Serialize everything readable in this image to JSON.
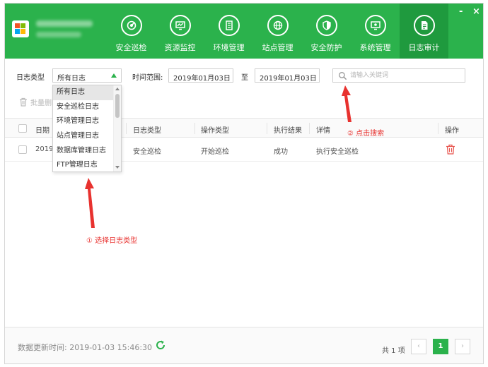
{
  "header": {
    "nav": [
      {
        "label": "安全巡检",
        "icon": "radar-icon"
      },
      {
        "label": "资源监控",
        "icon": "monitor-icon"
      },
      {
        "label": "环境管理",
        "icon": "server-icon"
      },
      {
        "label": "站点管理",
        "icon": "globe-icon"
      },
      {
        "label": "安全防护",
        "icon": "shield-icon"
      },
      {
        "label": "系统管理",
        "icon": "settings-monitor-icon"
      },
      {
        "label": "日志审计",
        "icon": "document-icon"
      }
    ],
    "active_tab": "日志审计",
    "minimize": "-",
    "close": "×"
  },
  "filters": {
    "log_type_label": "日志类型",
    "log_type_value": "所有日志",
    "time_range_label": "时间范围:",
    "start_date": "2019年01月03日",
    "to_label": "至",
    "end_date": "2019年01月03日",
    "search_placeholder": "请输入关键词"
  },
  "dropdown": {
    "options": [
      "所有日志",
      "安全巡检日志",
      "环境管理日志",
      "站点管理日志",
      "数据库管理日志",
      "FTP管理日志"
    ],
    "selected": "所有日志"
  },
  "batch_delete": "批量删除",
  "table": {
    "headers": [
      "日期",
      "日志类型",
      "操作类型",
      "执行结果",
      "详情",
      "操作"
    ],
    "rows": [
      {
        "date": "2019-01-03 15:46:30",
        "date_visible": "2019",
        "type": "安全巡检",
        "action": "开始巡检",
        "result": "成功",
        "detail": "执行安全巡检"
      }
    ]
  },
  "annotations": {
    "step1": "① 选择日志类型",
    "step2": "② 点击搜索"
  },
  "footer": {
    "update_time": "数据更新时间: 2019-01-03 15:46:30",
    "total": "共 1 项",
    "current_page": "1",
    "prev": "‹",
    "next": "›"
  },
  "colors": {
    "brand": "#2bb24c",
    "brand_dark": "#1f9a3e",
    "annotation": "#e8322f",
    "delete": "#e8554e"
  }
}
